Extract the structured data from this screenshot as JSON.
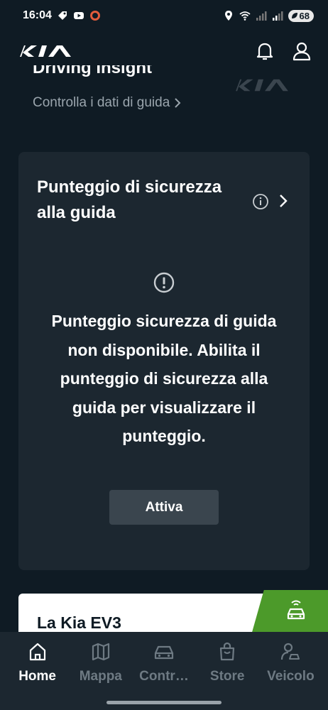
{
  "status_bar": {
    "time": "16:04",
    "battery": "68",
    "icons_left": [
      "tag-icon",
      "youtube-icon",
      "circle-icon"
    ],
    "icons_right": [
      "location-icon",
      "wifi-icon",
      "signal-icon",
      "signal-icon",
      "battery-icon"
    ]
  },
  "header": {
    "logo": "KIA",
    "icons": [
      "bell-icon",
      "user-icon"
    ]
  },
  "insight": {
    "title": "Driving Insight",
    "link": "Controlla i dati di guida"
  },
  "safety_card": {
    "title": "Punteggio di sicurezza alla guida",
    "message": "Punteggio sicurezza di guida non disponibile. Abilita il punteggio di sicurezza alla guida per visualizzare il punteggio.",
    "button_label": "Attiva"
  },
  "promo": {
    "title": "La Kia EV3",
    "badge_icon": "car-wifi-icon",
    "accent": "#4c9a2a"
  },
  "nav": {
    "items": [
      {
        "label": "Home",
        "icon": "home-icon",
        "active": true
      },
      {
        "label": "Mappa",
        "icon": "map-icon",
        "active": false
      },
      {
        "label": "Contr…",
        "icon": "car-icon",
        "active": false
      },
      {
        "label": "Store",
        "icon": "shopping-bag-icon",
        "active": false
      },
      {
        "label": "Veicolo",
        "icon": "user-car-icon",
        "active": false
      }
    ]
  },
  "colors": {
    "background": "#0f1b24",
    "card": "#1c2730",
    "button": "#3a454e",
    "muted_text": "#9aa5ad",
    "inactive_nav": "#6e7a83"
  }
}
